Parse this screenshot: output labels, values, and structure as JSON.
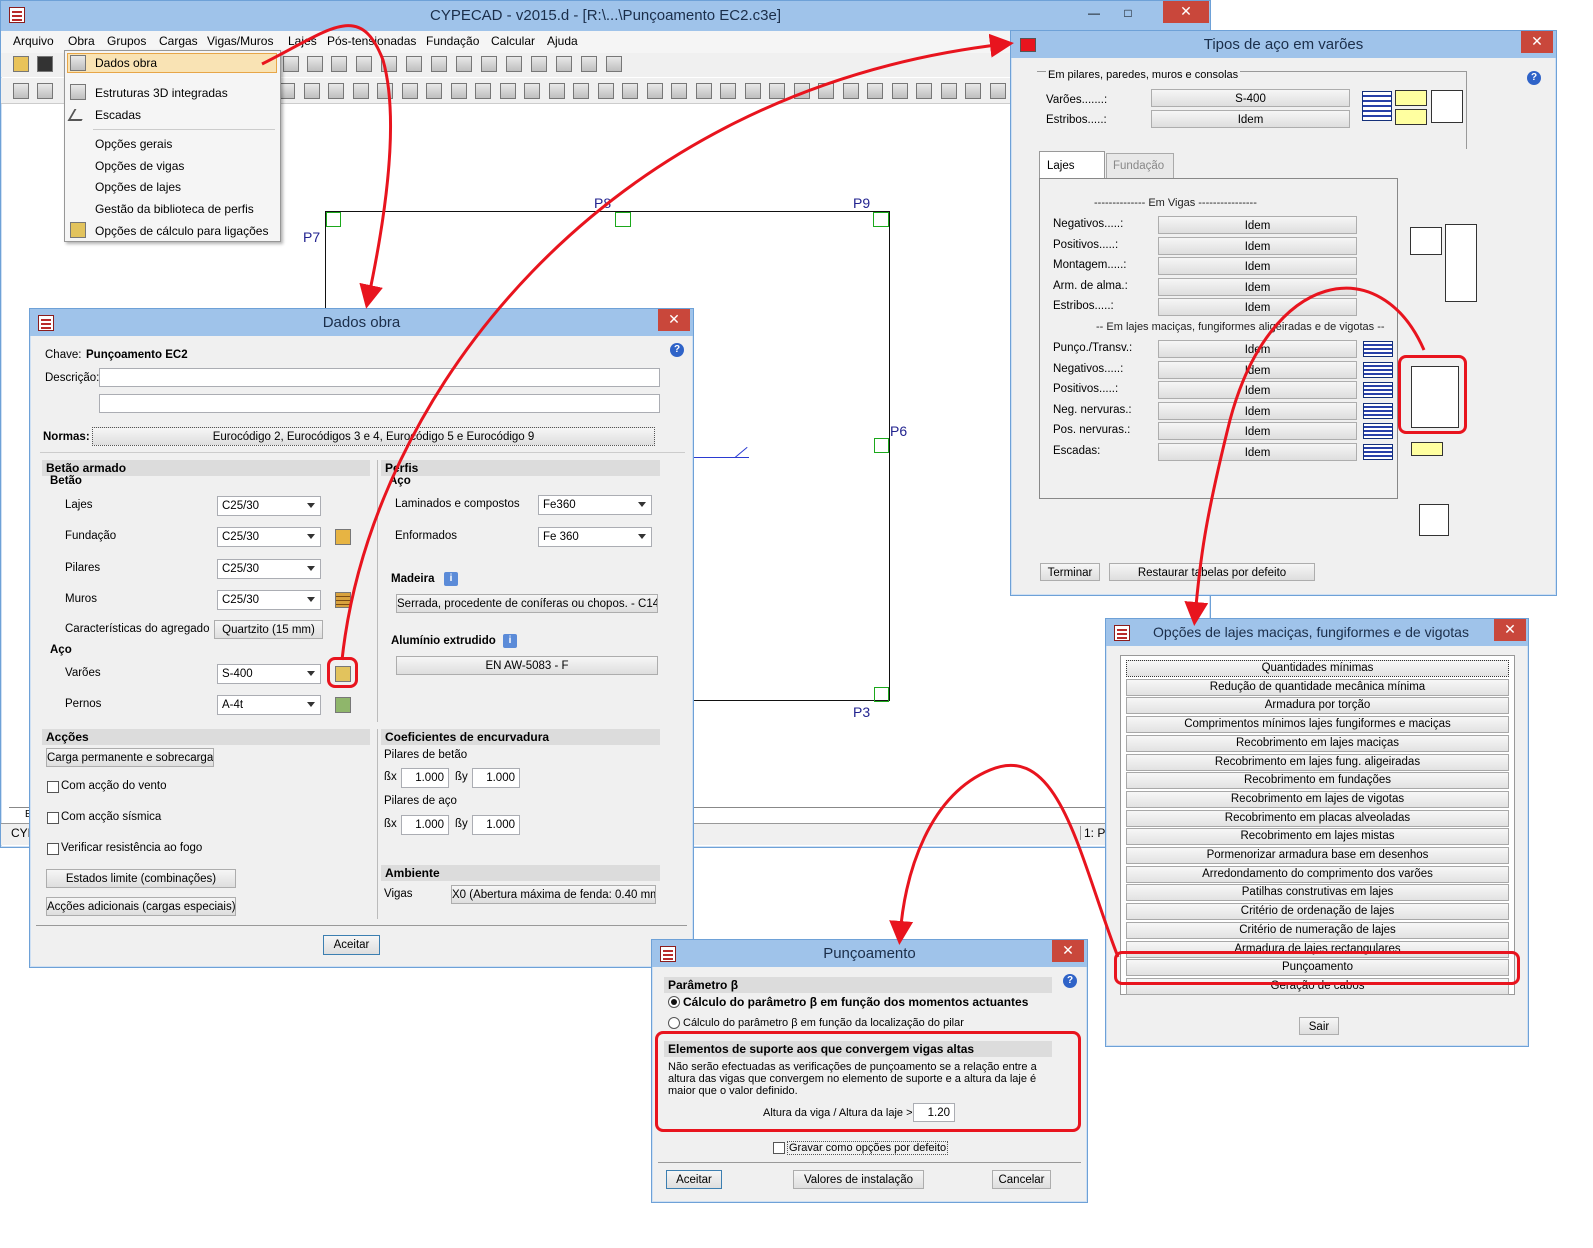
{
  "main_window": {
    "title": "CYPECAD - v2015.d - [R:\\...\\Punçoamento EC2.c3e]",
    "menu": [
      "Arquivo",
      "Obra",
      "Grupos",
      "Cargas",
      "Vigas/Muros",
      "Lajes",
      "Pós-tensionadas",
      "Fundação",
      "Calcular",
      "Ajuda"
    ],
    "status_left": "CYP",
    "status_right": "1: Pis",
    "tab_left": "E",
    "pillars": [
      "P7",
      "P8",
      "P9",
      "P6",
      "P3"
    ]
  },
  "obra_menu": {
    "items": [
      "Dados obra",
      "Estruturas 3D integradas",
      "Escadas",
      "Opções gerais",
      "Opções de vigas",
      "Opções de lajes",
      "Gestão da biblioteca de perfis",
      "Opções de cálculo para ligações"
    ]
  },
  "dados_obra": {
    "title": "Dados obra",
    "chave_label": "Chave:",
    "chave_value": "Punçoamento EC2",
    "descricao_label": "Descrição:",
    "normas_label": "Normas:",
    "normas_value": "Eurocódigo 2, Eurocódigos 3 e 4, Eurocódigo 5 e Eurocódigo 9",
    "betao_armado": "Betão armado",
    "betao": "Betão",
    "lajes_label": "Lajes",
    "lajes_value": "C25/30",
    "fundacao_label": "Fundação",
    "fundacao_value": "C25/30",
    "pilares_label": "Pilares",
    "pilares_value": "C25/30",
    "muros_label": "Muros",
    "muros_value": "C25/30",
    "agregado_label": "Características do agregado",
    "agregado_value": "Quartzito (15 mm)",
    "aco": "Aço",
    "varoes_label": "Varões",
    "varoes_value": "S-400",
    "pernos_label": "Pernos",
    "pernos_value": "A-4t",
    "perfis": "Perfis",
    "perfis_aco": "Aço",
    "laminados_label": "Laminados e compostos",
    "laminados_value": "Fe360",
    "enformados_label": "Enformados",
    "enformados_value": "Fe 360",
    "madeira": "Madeira",
    "madeira_value": "Serrada, procedente de coníferas ou chopos. - C14",
    "aluminio": "Alumínio extrudido",
    "aluminio_value": "EN AW-5083 - F",
    "accoes": "Acções",
    "carga_button": "Carga permanente e sobrecarga",
    "vento": "Com acção do vento",
    "sismica": "Com acção sísmica",
    "fogo": "Verificar resistência ao fogo",
    "estados_button": "Estados limite (combinações)",
    "accoes_button": "Acções adicionais (cargas especiais)",
    "coef": "Coeficientes de encurvadura",
    "pilares_betao": "Pilares de betão",
    "pilares_aco": "Pilares de aço",
    "bx": "ßx",
    "by": "ßy",
    "bx_betao": "1.000",
    "by_betao": "1.000",
    "bx_aco": "1.000",
    "by_aco": "1.000",
    "ambiente": "Ambiente",
    "vigas_label": "Vigas",
    "vigas_value": "X0 (Abertura máxima de fenda: 0.40 mm)",
    "aceitar": "Aceitar"
  },
  "tipos_aco": {
    "title": "Tipos de aço em varões",
    "group_title": "Em pilares, paredes, muros e consolas",
    "varoes_label": "Varões.......:",
    "varoes_value": "S-400",
    "estribos_label": "Estribos.....:",
    "estribos_value": "Idem",
    "tab_lajes": "Lajes",
    "tab_fundacao": "Fundação",
    "em_vigas": "-------------- Em Vigas ----------------",
    "vigas_rows": [
      {
        "label": "Negativos.....:",
        "value": "Idem"
      },
      {
        "label": "Positivos.....:",
        "value": "Idem"
      },
      {
        "label": "Montagem.....:",
        "value": "Idem"
      },
      {
        "label": "Arm. de alma.:",
        "value": "Idem"
      },
      {
        "label": "Estribos.....:",
        "value": "Idem"
      }
    ],
    "em_lajes": "-- Em lajes maciças, fungiformes aligeiradas e de vigotas --",
    "lajes_rows": [
      {
        "label": "Punço./Transv.:",
        "value": "Idem"
      },
      {
        "label": "Negativos.....:",
        "value": "Idem"
      },
      {
        "label": "Positivos.....:",
        "value": "Idem"
      },
      {
        "label": "Neg. nervuras.:",
        "value": "Idem"
      },
      {
        "label": "Pos. nervuras.:",
        "value": "Idem"
      },
      {
        "label": "Escadas:",
        "value": "Idem"
      }
    ],
    "terminar": "Terminar",
    "restaurar": "Restaurar tabelas por defeito"
  },
  "opcoes_lajes": {
    "title": "Opções de lajes maciças, fungiformes e de vigotas",
    "items": [
      "Quantidades mínimas",
      "Redução de quantidade mecânica mínima",
      "Armadura por torção",
      "Comprimentos mínimos lajes fungiformes e maciças",
      "Recobrimento em lajes maciças",
      "Recobrimento em lajes fung. aligeiradas",
      "Recobrimento em fundações",
      "Recobrimento em lajes de vigotas",
      "Recobrimento em placas alveoladas",
      "Recobrimento em lajes mistas",
      "Pormenorizar armadura base em desenhos",
      "Arredondamento do comprimento dos varões",
      "Patilhas construtivas em lajes",
      "Critério de ordenação de lajes",
      "Critério de numeração de lajes",
      "Armadura de lajes rectangulares",
      "Punçoamento",
      "Geração de cabos"
    ],
    "sair": "Sair"
  },
  "puncoamento": {
    "title": "Punçoamento",
    "param_header": "Parâmetro β",
    "radio1": "Cálculo do parâmetro β em função dos momentos actuantes",
    "radio2": "Cálculo do parâmetro β em função da localização do pilar",
    "elem_header": "Elementos de suporte aos que convergem vigas altas",
    "description": "Não serão efectuadas as verificações de punçoamento se a relação entre a altura das vigas que convergem no elemento de suporte e a altura da laje é maior que o valor definido.",
    "ratio_label": "Altura da viga / Altura da laje >",
    "ratio_value": "1.20",
    "gravar": "Gravar como opções por defeito",
    "aceitar": "Aceitar",
    "valores": "Valores de instalação",
    "cancelar": "Cancelar"
  },
  "colors": {
    "accent": "#e8141e",
    "title_bar": "#9fc3ea",
    "close": "#c9473b"
  }
}
